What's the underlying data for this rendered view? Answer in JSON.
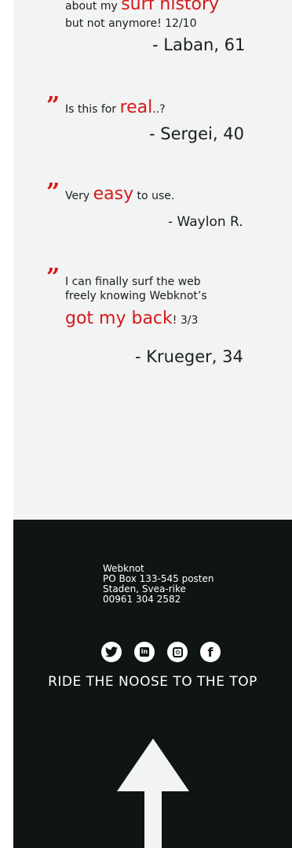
{
  "testimonials": [
    {
      "lines": [
        {
          "pre": "about my ",
          "hl": "surf history",
          "post": ""
        },
        {
          "pre": "but not anymore! 12/10",
          "hl": "",
          "post": ""
        }
      ],
      "author": "- Laban, 61"
    },
    {
      "lines": [
        {
          "pre": "Is this for ",
          "hl": "real",
          "post": "..?"
        }
      ],
      "author": "- Sergei, 40"
    },
    {
      "lines": [
        {
          "pre": "Very ",
          "hl": "easy",
          "post": " to use."
        }
      ],
      "author": "- Waylon R."
    },
    {
      "lines": [
        {
          "pre": "I can finally surf the web",
          "hl": "",
          "post": ""
        },
        {
          "pre": "freely knowing Webknot’s",
          "hl": "",
          "post": ""
        },
        {
          "pre": "",
          "hl": "got my back",
          "post": "! 3/3"
        }
      ],
      "author": "- Krueger, 34"
    }
  ],
  "footer": {
    "address": [
      "Webknot",
      "PO Box 133-545 posten",
      "Staden, Svea-rike",
      "00961 304 2582"
    ],
    "socials": [
      {
        "icon": "twitter-icon",
        "glyph": "t"
      },
      {
        "icon": "linkedin-icon",
        "glyph": "in"
      },
      {
        "icon": "instagram-icon",
        "glyph": "◎"
      },
      {
        "icon": "facebook-icon",
        "glyph": "f"
      }
    ],
    "cta": "RIDE THE NOOSE TO THE TOP"
  },
  "colors": {
    "accent": "#d41a1a",
    "section_bg": "#f2f3f3",
    "footer_bg": "#0f1514",
    "text": "#1b1f1f"
  }
}
